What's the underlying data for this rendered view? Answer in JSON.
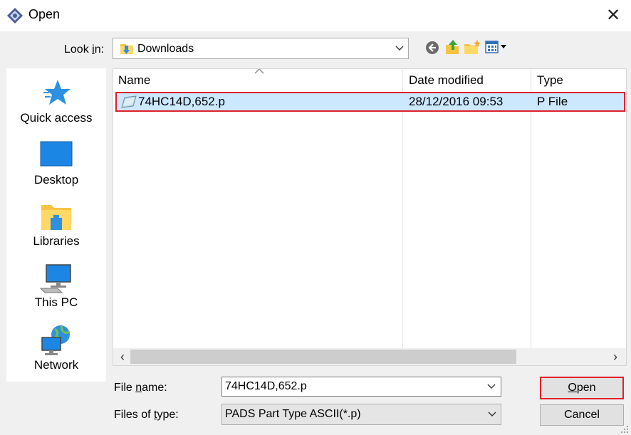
{
  "window": {
    "title": "Open",
    "close_glyph": "✕"
  },
  "toolbar": {
    "lookin_label_pre": "Look ",
    "lookin_label_accel": "i",
    "lookin_label_post": "n:",
    "current_folder": "Downloads",
    "icons": [
      "back-icon",
      "up-folder-icon",
      "new-folder-icon",
      "view-menu-icon"
    ]
  },
  "places": [
    {
      "label": "Quick access",
      "icon": "star-icon"
    },
    {
      "label": "Desktop",
      "icon": "desktop-icon"
    },
    {
      "label": "Libraries",
      "icon": "libraries-icon"
    },
    {
      "label": "This PC",
      "icon": "computer-icon"
    },
    {
      "label": "Network",
      "icon": "network-icon"
    }
  ],
  "filelist": {
    "columns": [
      "Name",
      "Date modified",
      "Type"
    ],
    "rows": [
      {
        "name": "74HC14D,652.p",
        "date": "28/12/2016 09:53",
        "type": "P File",
        "selected": true
      }
    ],
    "scroll_left": "‹",
    "scroll_right": "›"
  },
  "form": {
    "filename_label_pre": "File ",
    "filename_label_accel": "n",
    "filename_label_post": "ame:",
    "filename_value": "74HC14D,652.p",
    "filetype_label_pre": "Files of ",
    "filetype_label_accel": "t",
    "filetype_label_post": "ype:",
    "filetype_value": "PADS Part Type ASCII(*.p)"
  },
  "buttons": {
    "open_accel": "O",
    "open_rest": "pen",
    "cancel": "Cancel"
  },
  "colors": {
    "selection": "#cce8ff",
    "highlight_red": "#e0202a",
    "folder_yellow": "#f6c343",
    "icon_blue": "#2f8fe0"
  }
}
